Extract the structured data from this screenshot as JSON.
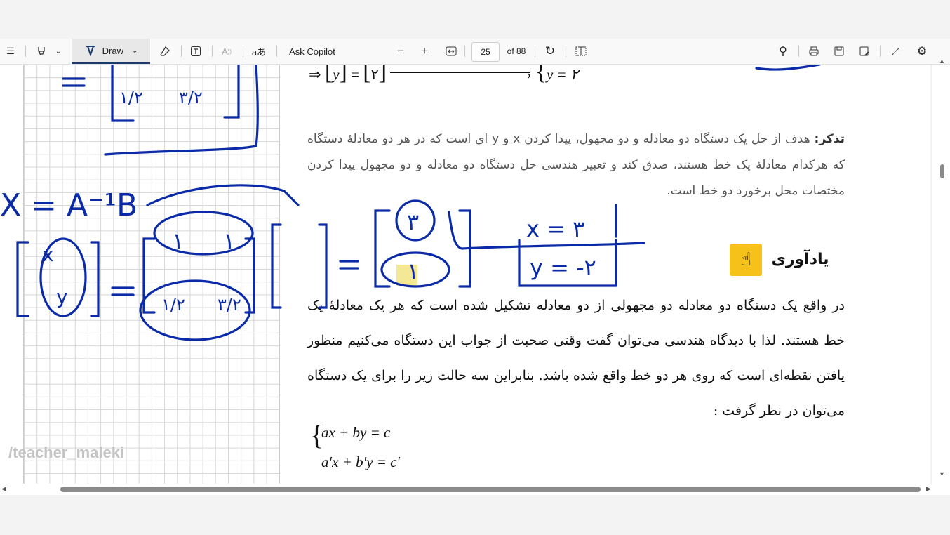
{
  "toolbar": {
    "draw_label": "Draw",
    "ask_copilot_label": "Ask Copilot",
    "page_current": "25",
    "page_total": "of 88",
    "zoom_out": "−",
    "zoom_in": "+"
  },
  "document": {
    "top_math": {
      "arrow": "⇒",
      "matrix_left": "y",
      "equals": "=",
      "matrix_right": "۲",
      "result": "y = ۲"
    },
    "note_label": "تذکر:",
    "note_text": " هدف از حل یک دستگاه دو معادله و دو مجهول، پیدا کردن x و y ای است که در هر دو معادلهٔ دستگاه که هرکدام معادلهٔ یک خط هستند، صدق کند و تعبیر هندسی حل دستگاه دو معادله و دو مجهول پیدا کردن مختصات محل برخورد دو خط است.",
    "heading": "یادآوری",
    "paragraph": "در واقع یک دستگاه دو معادله دو مجهولی از دو معادله تشکیل شده است که هر یک معادلهٔ یک خط هستند. لذا با دیدگاه هندسی می‌توان گفت وقتی صحبت از جواب این دستگاه می‌کنیم منظور یافتن نقطه‌ای است که روی هر دو خط واقع شده باشد. بنابراین سه حالت زیر را برای یک دستگاه می‌توان در نظر گرفت :",
    "system": [
      "ax + by = c",
      "a′x + b′y = c′"
    ]
  },
  "annotations": {
    "formula": "X = A⁻¹B",
    "x_result": "x = ۳",
    "y_result": "y = -۲",
    "top_fraction_a": "۱/۲",
    "top_fraction_b": "۳/۲",
    "matrix_entries": [
      "۱",
      "۱",
      "۱/۲",
      "۳/۲"
    ],
    "vector_lhs": [
      "x",
      "y"
    ],
    "vector_rhs": [
      "۳",
      "۱"
    ]
  },
  "watermark": "/teacher_maleki",
  "colors": {
    "ink": "#0a2aa8",
    "highlight": "#f3e27a"
  }
}
